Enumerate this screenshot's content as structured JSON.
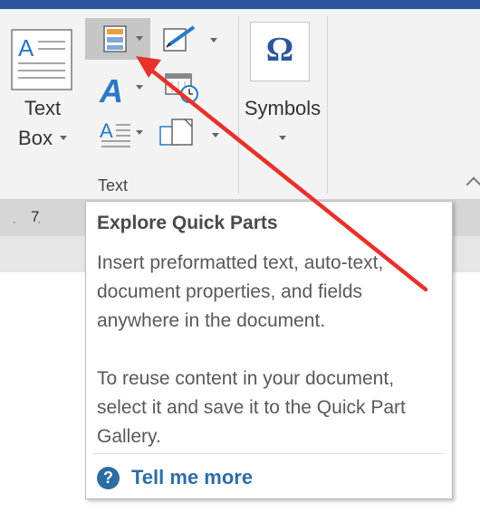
{
  "ribbon": {
    "text_box": {
      "line1": "Text",
      "line2": "Box"
    },
    "symbols_label": "Symbols",
    "symbol_glyph": "Ω",
    "group_label": "Text",
    "quick_parts_icon": "quick-parts-icon",
    "wordart_glyph": "A",
    "drop_cap_glyph": "A"
  },
  "ruler": {
    "number": "7"
  },
  "tooltip": {
    "title": "Explore Quick Parts",
    "paragraph1": "Insert preformatted text, auto-text, document properties, and fields anywhere in the document.",
    "paragraph2": "To reuse content in your document, select it and save it to the Quick Part Gallery.",
    "help_glyph": "?",
    "link": "Tell me more"
  },
  "colors": {
    "accent": "#2e6da4",
    "arrow": "#e8312b",
    "highlight": "#c6c6c6",
    "ribbon": "#f3f3f3"
  }
}
